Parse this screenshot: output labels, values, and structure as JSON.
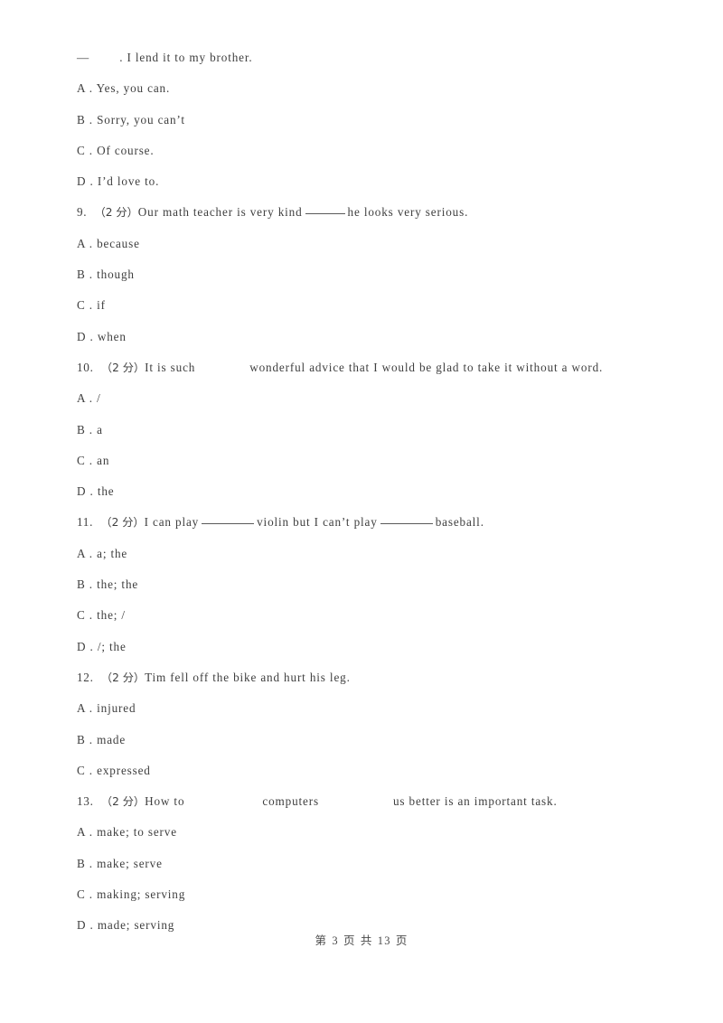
{
  "document": {
    "type": "exam-paper",
    "language": "English test with Chinese annotations",
    "background_color": "#ffffff",
    "text_color": "#3f3f3f"
  },
  "questions": [
    {
      "number": "",
      "marks": "",
      "stem_prefix": "—",
      "stem_suffix": ". I lend it to my brother.",
      "options": [
        {
          "letter": "A",
          "separator": " .",
          "text": "Yes, you can."
        },
        {
          "letter": "B",
          "separator": " .",
          "text": "Sorry, you can’t"
        },
        {
          "letter": "C",
          "separator": " .",
          "text": "Of course."
        },
        {
          "letter": "D",
          "separator": " .",
          "text": "I’d love to."
        }
      ]
    },
    {
      "number": "9.",
      "marks": "（2 分）",
      "stem_before": "Our math teacher is very kind",
      "stem_after": "he looks very serious.",
      "options": [
        {
          "letter": "A",
          "separator": " .",
          "text": "because"
        },
        {
          "letter": "B",
          "separator": " .",
          "text": "though"
        },
        {
          "letter": "C",
          "separator": " .",
          "text": "if"
        },
        {
          "letter": "D",
          "separator": " .",
          "text": "when"
        }
      ]
    },
    {
      "number": "10.",
      "marks": "（2 分）",
      "stem_before": "It is such",
      "stem_after": "wonderful advice that I would be glad to take it without a word.",
      "options": [
        {
          "letter": "A",
          "separator": " .",
          "text": "/"
        },
        {
          "letter": "B",
          "separator": " .",
          "text": "a"
        },
        {
          "letter": "C",
          "separator": " .",
          "text": "an"
        },
        {
          "letter": "D",
          "separator": " .",
          "text": "the"
        }
      ]
    },
    {
      "number": "11.",
      "marks": "（2 分）",
      "stem_part1": "I can play",
      "stem_part2": "violin but I can’t play",
      "stem_part3": "baseball.",
      "options": [
        {
          "letter": "A",
          "separator": " .",
          "text": "a; the"
        },
        {
          "letter": "B",
          "separator": " .",
          "text": "the; the"
        },
        {
          "letter": "C",
          "separator": " .",
          "text": "the; /"
        },
        {
          "letter": "D",
          "separator": " .",
          "text": "/; the"
        }
      ]
    },
    {
      "number": "12.",
      "marks": "（2 分）",
      "stem": "Tim fell off the bike and hurt his leg.",
      "options": [
        {
          "letter": "A",
          "separator": " .",
          "text": "injured"
        },
        {
          "letter": "B",
          "separator": " .",
          "text": "made"
        },
        {
          "letter": "C",
          "separator": " .",
          "text": "expressed"
        }
      ]
    },
    {
      "number": "13.",
      "marks": "（2 分）",
      "stem_part1": "How to",
      "stem_part2": "computers",
      "stem_part3": "us better is an important task.",
      "options": [
        {
          "letter": "A",
          "separator": " .",
          "text": "make; to serve"
        },
        {
          "letter": "B",
          "separator": " .",
          "text": "make; serve"
        },
        {
          "letter": "C",
          "separator": " .",
          "text": "making; serving"
        },
        {
          "letter": "D",
          "separator": " .",
          "text": "made; serving"
        }
      ]
    }
  ],
  "footer": {
    "prefix": "第",
    "current_page": "3",
    "middle": "页 共",
    "total_pages": "13",
    "suffix": "页"
  }
}
